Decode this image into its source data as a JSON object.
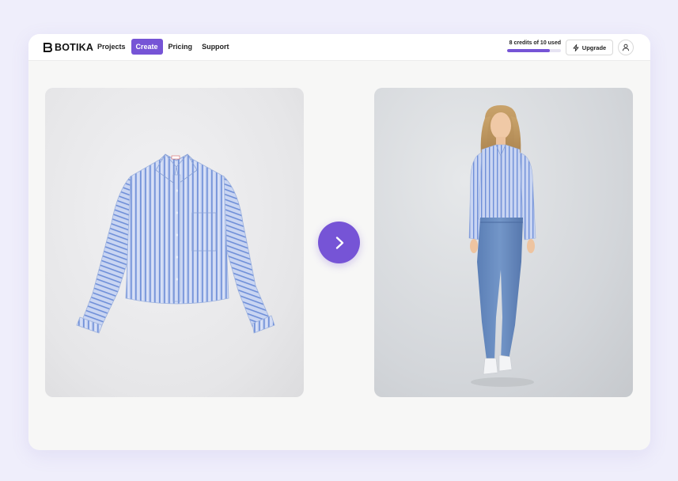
{
  "brand": {
    "name": "BOTIKA",
    "icon": "botika-logo-icon"
  },
  "nav": {
    "links": [
      {
        "label": "Projects",
        "active": false
      },
      {
        "label": "Create",
        "active": true
      },
      {
        "label": "Pricing",
        "active": false
      },
      {
        "label": "Support",
        "active": false
      }
    ]
  },
  "credits": {
    "text": "8 credits of 10 used",
    "used": 8,
    "total": 10
  },
  "actions": {
    "upgrade_label": "Upgrade",
    "upgrade_icon": "lightning-icon",
    "profile_icon": "user-icon"
  },
  "main": {
    "source_image": "striped-shirt-product-photo",
    "result_image": "model-wearing-striped-shirt-photo",
    "transform_icon": "chevron-right-icon"
  },
  "colors": {
    "accent": "#7654d6",
    "page_bg": "#efeefb",
    "card_bg": "#f7f7f6"
  }
}
